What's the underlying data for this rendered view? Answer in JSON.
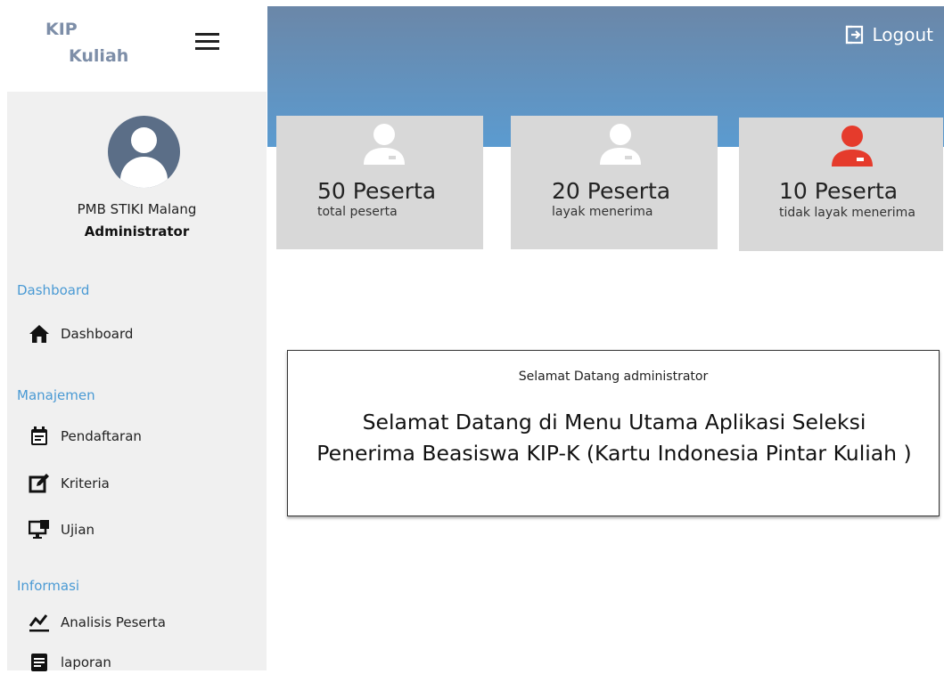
{
  "brand": {
    "line1": "KIP",
    "line2": "Kuliah"
  },
  "user": {
    "name": "PMB STIKI Malang",
    "role": "Administrator"
  },
  "sidebar": {
    "sections": [
      {
        "label": "Dashboard",
        "items": [
          {
            "label": "Dashboard",
            "icon": "home-icon"
          }
        ]
      },
      {
        "label": "Manajemen",
        "items": [
          {
            "label": "Pendaftaran",
            "icon": "calendar-icon"
          },
          {
            "label": "Kriteria",
            "icon": "edit-icon"
          },
          {
            "label": "Ujian",
            "icon": "monitor-icon"
          }
        ]
      },
      {
        "label": "Informasi",
        "items": [
          {
            "label": "Analisis Peserta",
            "icon": "chart-line-icon"
          },
          {
            "label": "laporan",
            "icon": "document-icon"
          }
        ]
      }
    ]
  },
  "header": {
    "logout_label": "Logout"
  },
  "stats": [
    {
      "value": "50 Peserta",
      "label": "total peserta",
      "icon_color": "#ffffff"
    },
    {
      "value": "20 Peserta",
      "label": "layak menerima",
      "icon_color": "#ffffff"
    },
    {
      "value": "10 Peserta",
      "label": "tidak layak menerima",
      "icon_color": "#e53b2c"
    }
  ],
  "welcome": {
    "greeting": "Selamat Datang administrator",
    "message": "Selamat Datang di Menu Utama Aplikasi Seleksi Penerima Beasiswa KIP-K (Kartu Indonesia Pintar Kuliah )"
  },
  "colors": {
    "accent": "#4a9ad4",
    "header_top": "#6b87a8",
    "header_bottom": "#5b9bd0",
    "avatar": "#5b6e87",
    "alert": "#e53b2c"
  }
}
